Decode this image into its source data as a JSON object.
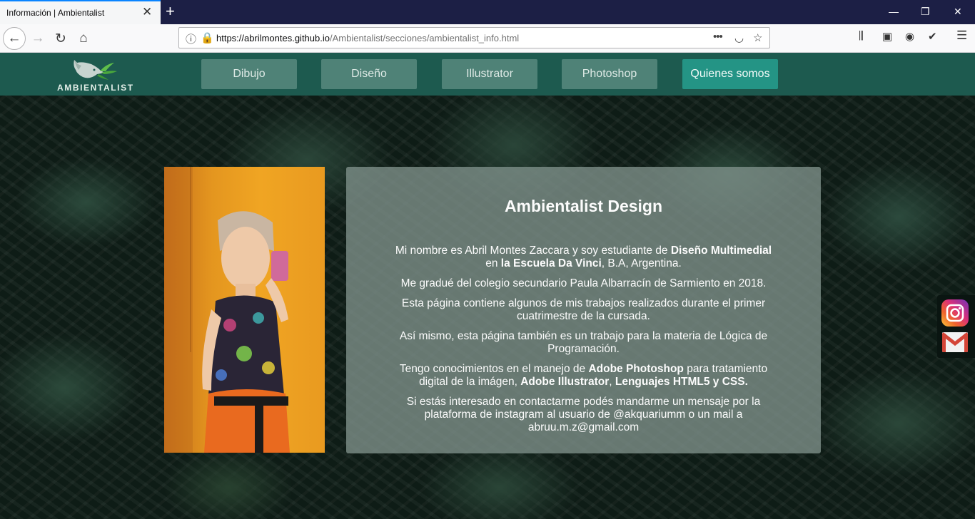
{
  "browser": {
    "tab_title": "Información | Ambientalist",
    "url_host": "https://abrilmontes.github.io",
    "url_path": "/Ambientalist/secciones/ambientalist_info.html",
    "page_actions_glyph": "•••"
  },
  "site": {
    "logo_text": "AMBIENTALIST",
    "brand_color": "#1d5a4f",
    "menu": [
      {
        "label": "Dibujo",
        "active": false
      },
      {
        "label": "Diseño",
        "active": false
      },
      {
        "label": "Illustrator",
        "active": false
      },
      {
        "label": "Photoshop",
        "active": false
      },
      {
        "label": "Quienes somos",
        "active": true
      }
    ]
  },
  "info": {
    "title": "Ambientalist Design",
    "p1_a": "Mi nombre es Abril Montes Zaccara y soy estudiante de ",
    "p1_b": "Diseño Multimedial",
    "p1_c": " en ",
    "p1_d": "la Escuela Da Vinci",
    "p1_e": ", B.A, Argentina.",
    "p2": "Me gradué del colegio secundario Paula Albarracín de Sarmiento en 2018.",
    "p3": "Esta página contiene algunos de mis trabajos realizados durante el primer cuatrimestre de la cursada.",
    "p4": "Así mismo, esta página también es un trabajo para la materia de Lógica de Programación.",
    "p5_a": "Tengo conocimientos en el manejo de ",
    "p5_b": "Adobe Photoshop",
    "p5_c": " para tratamiento digital de la imágen, ",
    "p5_d": "Adobe Illustrator",
    "p5_e": ", ",
    "p5_f": "Lenguajes HTML5 y CSS.",
    "p6": "Si estás interesado en contactarme podés mandarme un mensaje por la plataforma de instagram al usuario de @akquariumm o un mail a abruu.m.z@gmail.com"
  },
  "icons": {
    "profile_photo": "portrait-photo",
    "instagram": "instagram-icon",
    "gmail": "gmail-icon"
  }
}
